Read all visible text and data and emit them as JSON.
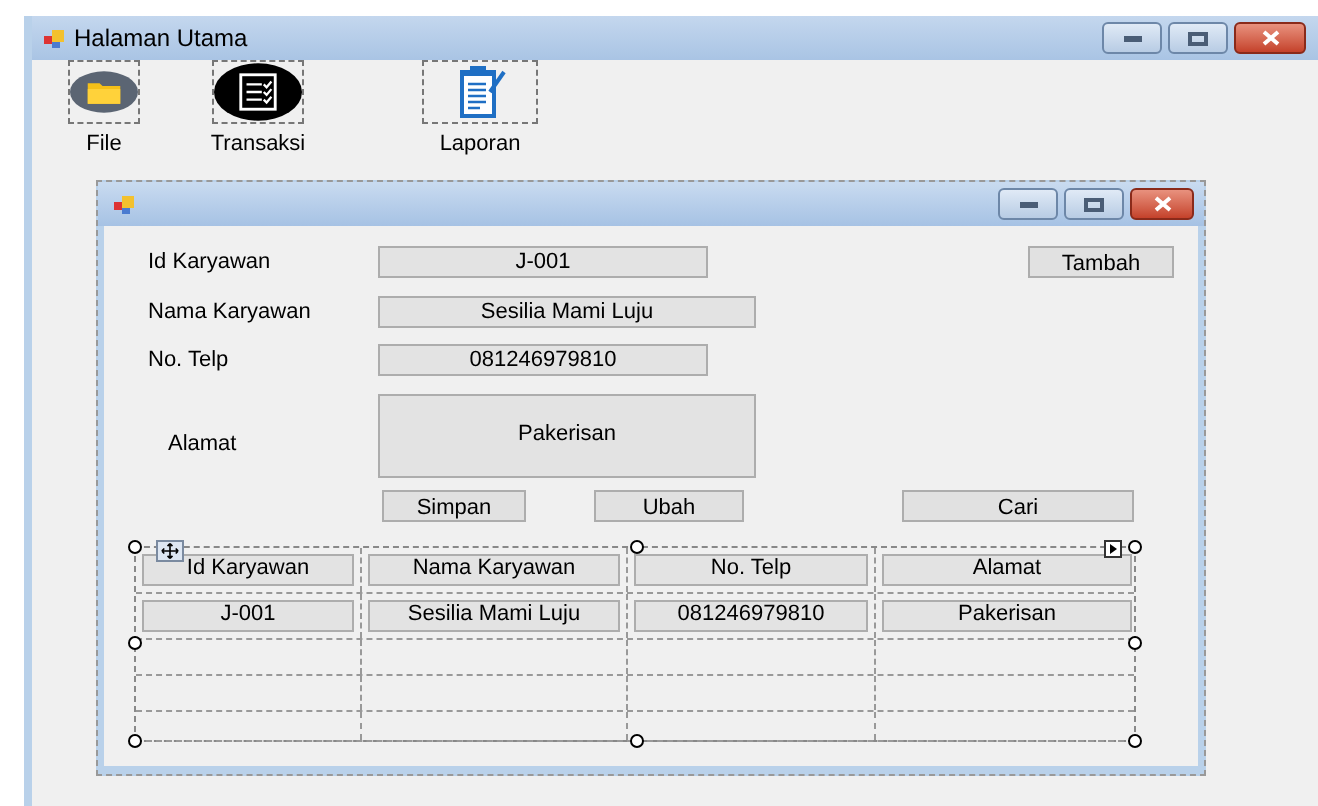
{
  "window": {
    "title": "Halaman Utama"
  },
  "toolbar": [
    {
      "label": "File"
    },
    {
      "label": "Transaksi"
    },
    {
      "label": "Laporan"
    }
  ],
  "form": {
    "fields": [
      {
        "label": "Id Karyawan",
        "value": "J-001",
        "kind": "short"
      },
      {
        "label": "Nama Karyawan",
        "value": "Sesilia Mami Luju",
        "kind": "wide"
      },
      {
        "label": "No. Telp",
        "value": "081246979810",
        "kind": "short"
      },
      {
        "label": "Alamat",
        "value": "Pakerisan",
        "kind": "tall"
      }
    ],
    "add_button": "Tambah",
    "action_buttons": [
      "Simpan",
      "Ubah",
      "Cari"
    ],
    "table": {
      "columns": [
        "Id Karyawan",
        "Nama Karyawan",
        "No. Telp",
        "Alamat"
      ],
      "rows": [
        [
          "J-001",
          "Sesilia Mami Luju",
          "081246979810",
          "Pakerisan"
        ]
      ]
    }
  }
}
